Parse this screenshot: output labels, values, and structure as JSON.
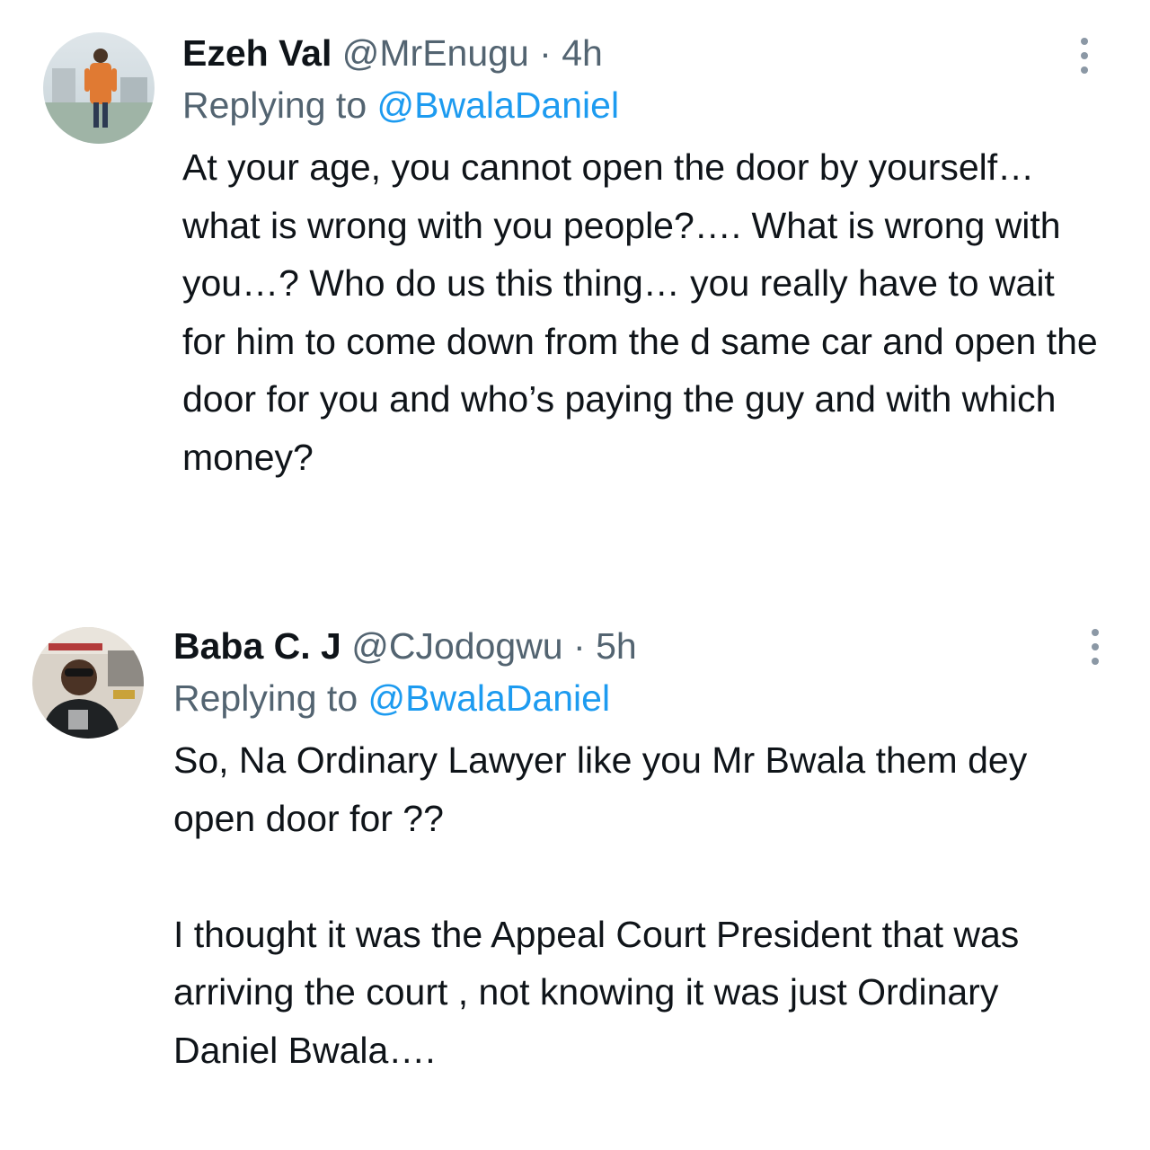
{
  "tweets": [
    {
      "author_name": "Ezeh Val",
      "handle": "@MrEnugu",
      "separator": "·",
      "time": "4h",
      "replying_prefix": "Replying to",
      "replying_to": "@BwalaDaniel",
      "text": "At your age, you cannot open the door by yourself… what is wrong with you people?…. What is wrong with you…? Who do us this thing… you really have to wait for him to come down from the d same car and open the door for you and who’s paying the guy and with which money?",
      "more_icon": "more-vertical-icon"
    },
    {
      "author_name": "Baba C. J",
      "handle": "@CJodogwu",
      "separator": "·",
      "time": "5h",
      "replying_prefix": "Replying to",
      "replying_to": "@BwalaDaniel",
      "text": "So, Na Ordinary Lawyer like you Mr Bwala them dey open door for ??\n\nI thought it was the Appeal Court President that was arriving the court , not knowing it was just Ordinary Daniel Bwala….",
      "more_icon": "more-vertical-icon"
    }
  ],
  "colors": {
    "text": "#0f1419",
    "secondary": "#536471",
    "link": "#1d9bf0",
    "icon": "#8b98a5"
  }
}
